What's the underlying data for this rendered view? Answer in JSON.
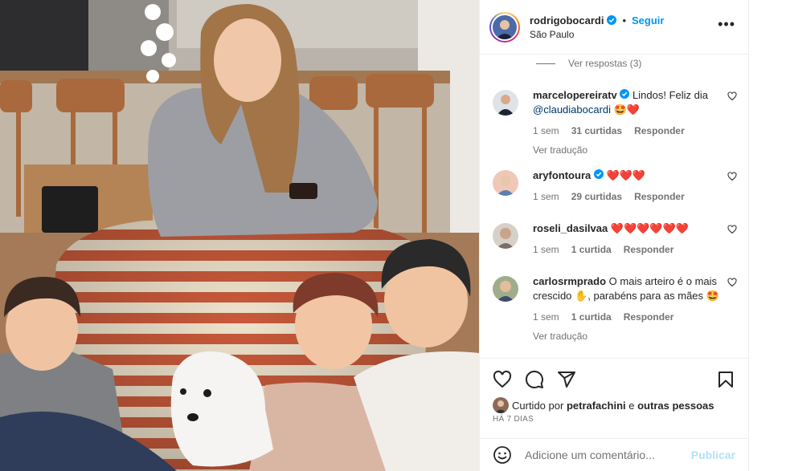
{
  "post": {
    "username": "rodrigobocardi",
    "follow_label": "Seguir",
    "separator": "•",
    "location": "São Paulo"
  },
  "view_replies": "Ver respostas (3)",
  "comments": [
    {
      "user": "marcelopereiratv",
      "verified": true,
      "text_before": "Lindos! Feliz dia",
      "mention": "@claudiabocardi",
      "emoji": "🤩❤️",
      "time": "1 sem",
      "likes": "31 curtidas",
      "reply": "Responder",
      "translate": "Ver tradução"
    },
    {
      "user": "aryfontoura",
      "verified": true,
      "emoji": "❤️❤️❤️",
      "time": "1 sem",
      "likes": "29 curtidas",
      "reply": "Responder"
    },
    {
      "user": "roseli_dasilvaa",
      "verified": false,
      "emoji": "❤️❤️❤️❤️❤️❤️",
      "time": "1 sem",
      "likes": "1 curtida",
      "reply": "Responder"
    },
    {
      "user": "carlosrmprado",
      "verified": false,
      "text_1": "O mais arteiro é o mais crescido",
      "emoji_1": "✋",
      "text_2": ", parabéns para as mães",
      "emoji_2": "🤩",
      "time": "1 sem",
      "likes": "1 curtida",
      "reply": "Responder",
      "translate": "Ver tradução"
    }
  ],
  "liked_by": {
    "prefix": "Curtido por",
    "user": "petrafachini",
    "conj": "e",
    "others": "outras pessoas"
  },
  "date": "HÁ 7 DIAS",
  "add_comment": {
    "placeholder": "Adicione um comentário...",
    "publish": "Publicar"
  },
  "icons": {
    "more": "more-options-icon",
    "like": "heart-icon",
    "comment": "comment-icon",
    "share": "share-icon",
    "save": "bookmark-icon",
    "emoji": "emoji-icon",
    "verified": "verified-badge-icon"
  },
  "colors": {
    "link_blue": "#0095f6",
    "publish_disabled": "#b2dffc",
    "secondary_text": "#737373",
    "heart_red": "#ed1c24"
  }
}
